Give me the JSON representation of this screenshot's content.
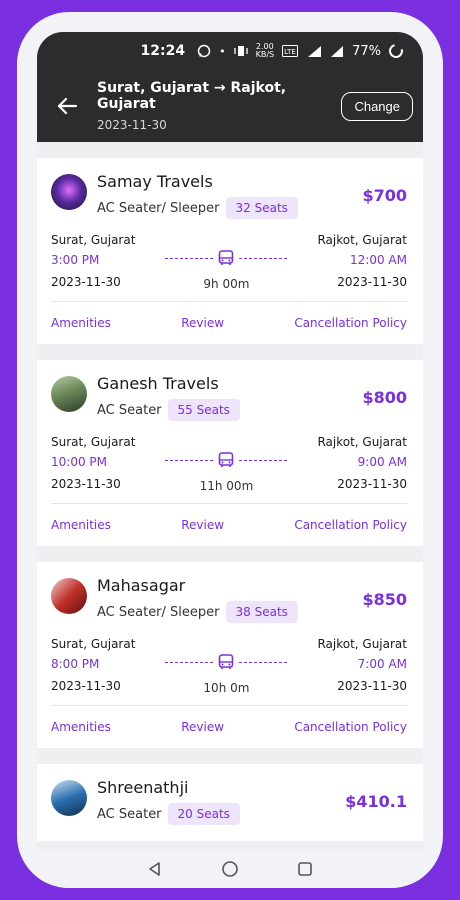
{
  "status": {
    "time": "12:24",
    "net_speed": "2.00",
    "net_unit": "KB/S",
    "battery": "77%"
  },
  "header": {
    "route": "Surat, Gujarat → Rajkot, Gujarat",
    "date": "2023-11-30",
    "change_label": "Change"
  },
  "links": {
    "amenities": "Amenities",
    "review": "Review",
    "cancellation": "Cancellation Policy"
  },
  "buses": [
    {
      "name": "Samay Travels",
      "type": "AC Seater/ Sleeper",
      "seats": "32 Seats",
      "price": "$700",
      "from": "Surat, Gujarat",
      "dep_time": "3:00 PM",
      "dep_date": "2023-11-30",
      "to": "Rajkot, Gujarat",
      "arr_time": "12:00 AM",
      "arr_date": "2023-11-30",
      "duration": "9h 00m",
      "avatar_color": "#4a2a8a"
    },
    {
      "name": "Ganesh Travels",
      "type": "AC Seater",
      "seats": "55 Seats",
      "price": "$800",
      "from": "Surat, Gujarat",
      "dep_time": "10:00 PM",
      "dep_date": "2023-11-30",
      "to": "Rajkot, Gujarat",
      "arr_time": "9:00 AM",
      "arr_date": "2023-11-30",
      "duration": "11h 00m",
      "avatar_color": "#6b8a5a"
    },
    {
      "name": "Mahasagar",
      "type": "AC Seater/ Sleeper",
      "seats": "38 Seats",
      "price": "$850",
      "from": "Surat, Gujarat",
      "dep_time": "8:00 PM",
      "dep_date": "2023-11-30",
      "to": "Rajkot, Gujarat",
      "arr_time": "7:00 AM",
      "arr_date": "2023-11-30",
      "duration": "10h 0m",
      "avatar_color": "#c0302a"
    },
    {
      "name": "Shreenathji",
      "type": "AC Seater",
      "seats": "20 Seats",
      "price": "$410.1",
      "avatar_color": "#2a6fb0"
    }
  ],
  "colors": {
    "accent": "#7a2fe0",
    "appbar": "#2c2c2e"
  }
}
